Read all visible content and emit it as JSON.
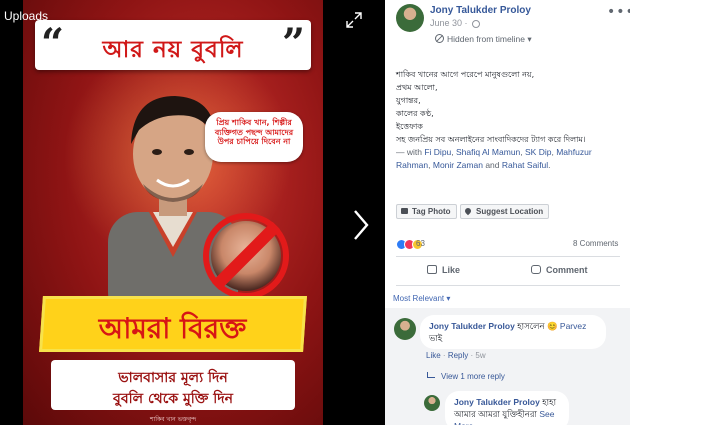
{
  "viewer": {
    "album_label": "Uploads",
    "icons": {
      "expand": "expand-icon",
      "next": "chevron-right-icon"
    }
  },
  "poster": {
    "banner_text": "আর নয় বুবলি",
    "quote_open": "“",
    "quote_close": "”",
    "bubble_text": "প্রিয় শাকিব খান, শিল্পীর ব্যক্তিগত পছন্দ আমাদের উপর চাপিয়ে দিবেন না",
    "headline": "আমরা বিরক্ত",
    "tagline_1": "ভালবাসার মূল্য দিন",
    "tagline_2": "বুবলি থেকে মুক্তি দিন",
    "signature": "শাকিব খান ভক্তবৃন্দ"
  },
  "post": {
    "author": "Jony Talukder Proloy",
    "date": "June 30",
    "audience_icon": "globe-icon",
    "visibility": "Hidden from timeline",
    "visibility_caret": "▾",
    "more_label": "•••",
    "body_lines": [
      "শাকিব খানের আগে পরেপে মানুষগুলো নয়,",
      "প্রথম আলো,",
      "যুগান্তর,",
      "কালের কণ্ঠ,",
      "ইত্তেফাক",
      "সহ জনপ্রিয় সব অনলাইনের সাংবাদিকদের ট্যাগ করে দিলাম।"
    ],
    "tags_prefix": " — with ",
    "tagged": [
      "Fi Dipu",
      "Shafiq Al Mamun",
      "SK Dip",
      "Mahfuzur Rahman",
      "Monir Zaman",
      "Rahat Saiful"
    ],
    "tag_sep": ", ",
    "tag_and": " and ",
    "tag_end": ".",
    "tag_photo_label": "Tag Photo",
    "suggest_location_label": "Suggest Location",
    "reaction_count": "63",
    "comment_count": "8 Comments",
    "like_label": "Like",
    "comment_label": "Comment",
    "sort_label": "Most Relevant",
    "sort_caret": "▾",
    "colors": {
      "link": "#385898",
      "reaction_like": "#2e7cf6",
      "reaction_love": "#f0375a",
      "reaction_haha": "#f7c531"
    }
  },
  "comments": [
    {
      "author": "Jony Talukder Proloy",
      "text": "হাসলেন",
      "emoji": "😊",
      "mention": "Parvez",
      "text_2": "ভাই",
      "like": "Like",
      "reply": "Reply",
      "dot": "·",
      "time": "5w"
    }
  ],
  "replies_label": "View 1 more reply",
  "reply_preview": {
    "author": "Jony Talukder Proloy",
    "text": "হাহা",
    "text_2": "আমার আমরা যুক্তিহীনরা",
    "see_more": "See More"
  }
}
